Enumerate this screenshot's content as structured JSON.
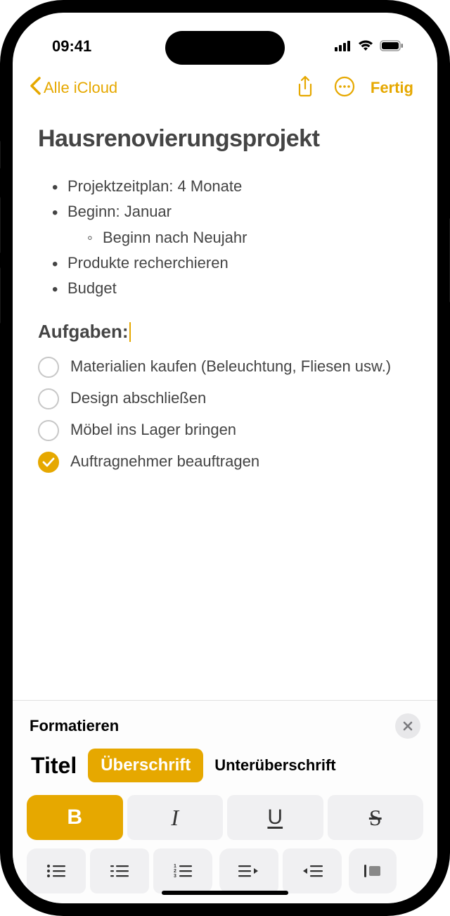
{
  "status": {
    "time": "09:41"
  },
  "nav": {
    "back_label": "Alle iCloud",
    "done_label": "Fertig"
  },
  "note": {
    "title": "Hausrenovierungsprojekt",
    "bullets": [
      "Projektzeitplan: 4 Monate",
      "Beginn: Januar",
      "Produkte recherchieren",
      "Budget"
    ],
    "sub_bullet": "Beginn nach Neujahr",
    "section_heading": "Aufgaben:",
    "tasks": [
      {
        "text": "Materialien kaufen (Beleuchtung, Fliesen usw.)",
        "checked": false
      },
      {
        "text": "Design abschließen",
        "checked": false
      },
      {
        "text": "Möbel ins Lager bringen",
        "checked": false
      },
      {
        "text": "Auftragnehmer beauftragen",
        "checked": true
      }
    ]
  },
  "format": {
    "panel_title": "Formatieren",
    "styles": {
      "title": "Titel",
      "heading": "Überschrift",
      "subheading": "Unterüberschrift"
    },
    "inline": {
      "bold": "B",
      "italic": "I",
      "underline": "U",
      "strike": "S"
    }
  }
}
